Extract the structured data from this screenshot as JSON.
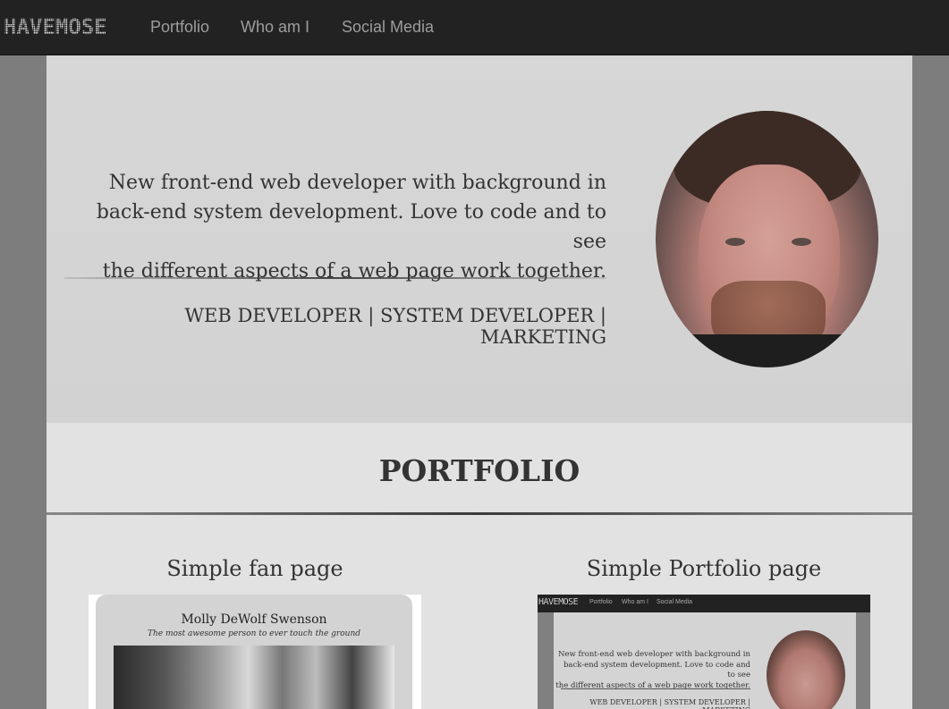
{
  "navbar": {
    "logo": "HAVEMOSE",
    "links": [
      "Portfolio",
      "Who am I",
      "Social Media"
    ]
  },
  "hero": {
    "intro_line1": "New front-end web developer with background in",
    "intro_line2": "back-end system development. Love to code and to see",
    "intro_line3": "the different aspects of a web page work together.",
    "skills": "WEB DEVELOPER | SYSTEM DEVELOPER | MARKETING"
  },
  "portfolio": {
    "heading": "PORTFOLIO",
    "projects": [
      {
        "title": "Simple fan page",
        "preview_title": "Molly DeWolf Swenson",
        "preview_subtitle": "The most awesome person to ever touch the ground"
      },
      {
        "title": "Simple Portfolio page",
        "preview_logo": "HAVEMOSE",
        "preview_links": [
          "Portfolio",
          "Who am I",
          "Social Media"
        ],
        "preview_line1": "New front-end web developer with background in",
        "preview_line2": "back-end system development. Love to code and to see",
        "preview_line3": "the different aspects of a web page work together.",
        "preview_skills": "WEB DEVELOPER | SYSTEM DEVELOPER | MARKETING"
      }
    ]
  },
  "colors": {
    "navbar_bg": "#222222",
    "nav_link": "#9d9d9d",
    "page_bg": "#7d7d7d",
    "hero_bg": "#d4d4d4",
    "content_bg": "#e2e2e2",
    "text": "#333333"
  }
}
